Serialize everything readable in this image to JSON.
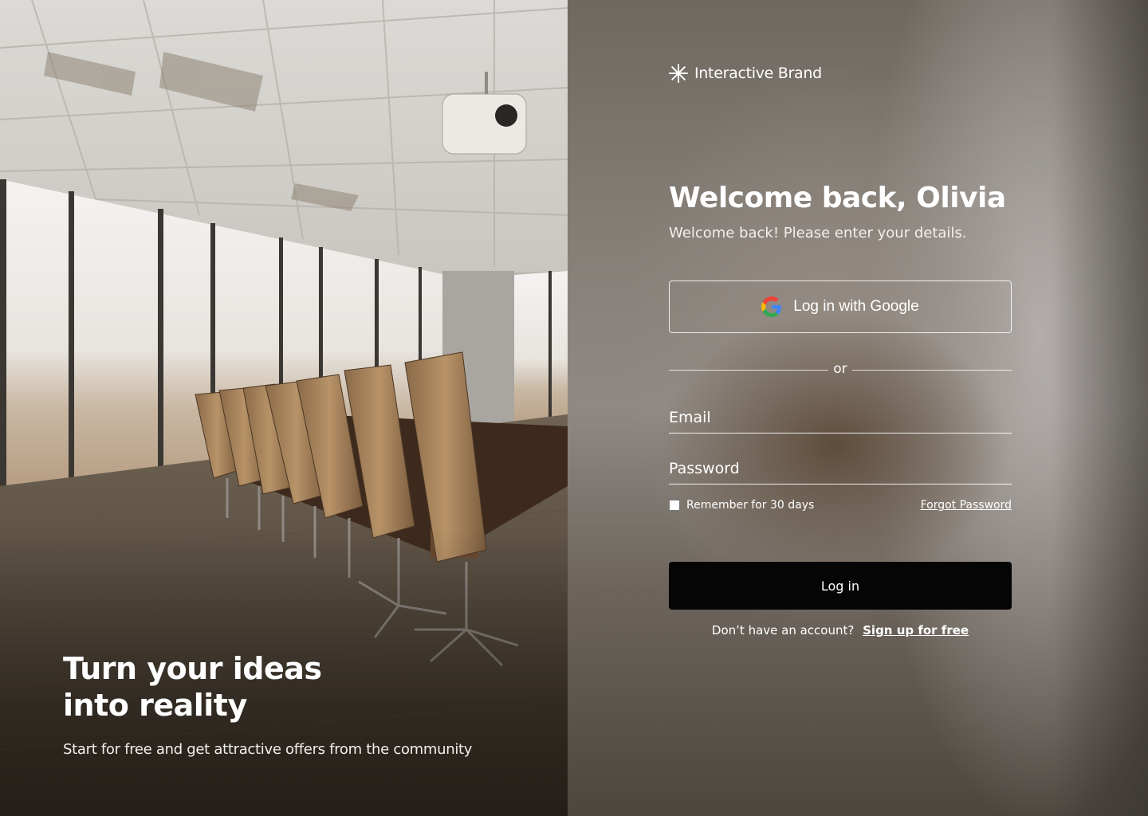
{
  "hero": {
    "title_line1": "Turn your ideas",
    "title_line2": "into reality",
    "subtitle": "Start for free and get attractive offers from the community"
  },
  "brand": {
    "icon": "asterisk-icon",
    "name": "Interactive Brand"
  },
  "login": {
    "title": "Welcome back, Olivia",
    "subtitle": "Welcome back! Please enter your details.",
    "google_button": {
      "icon": "google-icon",
      "label": "Log in with Google"
    },
    "divider_text": "or",
    "email": {
      "placeholder": "Email",
      "value": ""
    },
    "password": {
      "placeholder": "Password",
      "value": ""
    },
    "remember": {
      "label": "Remember for 30 days",
      "checked": false
    },
    "forgot_label": "Forgot Password",
    "submit_label": "Log in",
    "signup_prompt": "Don’t have an account?",
    "signup_link": "Sign up for free"
  },
  "colors": {
    "button_bg": "#050505",
    "text": "#ffffff",
    "google_blue": "#4285F4",
    "google_red": "#EA4335",
    "google_yellow": "#FBBC05",
    "google_green": "#34A853"
  }
}
